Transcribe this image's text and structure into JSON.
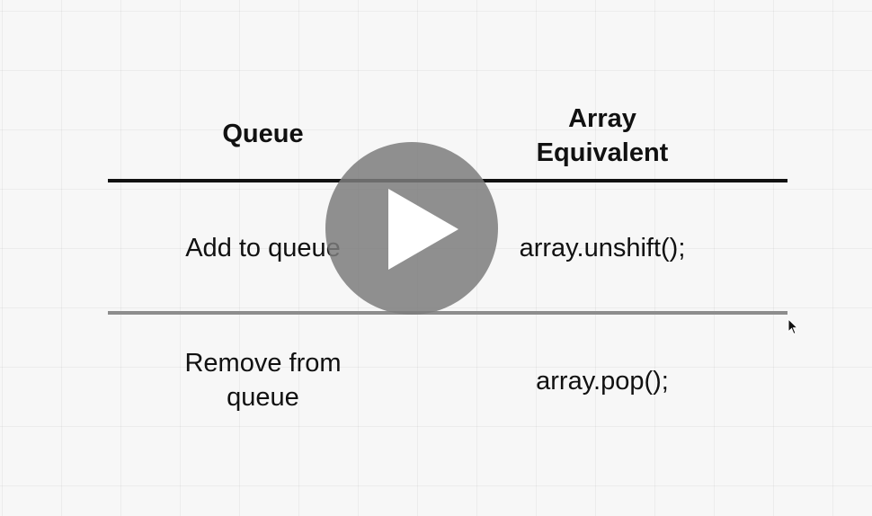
{
  "table": {
    "headers": {
      "queue": "Queue",
      "array_line1": "Array",
      "array_line2": "Equivalent"
    },
    "rows": [
      {
        "queue": "Add to queue",
        "array": "array.unshift();"
      },
      {
        "queue_line1": "Remove from",
        "queue_line2": "queue",
        "array": "array.pop();"
      }
    ]
  },
  "overlay": {
    "play_icon": "play-icon",
    "cursor_icon": "mouse-pointer-icon",
    "play_color": "#7d7d7d"
  }
}
